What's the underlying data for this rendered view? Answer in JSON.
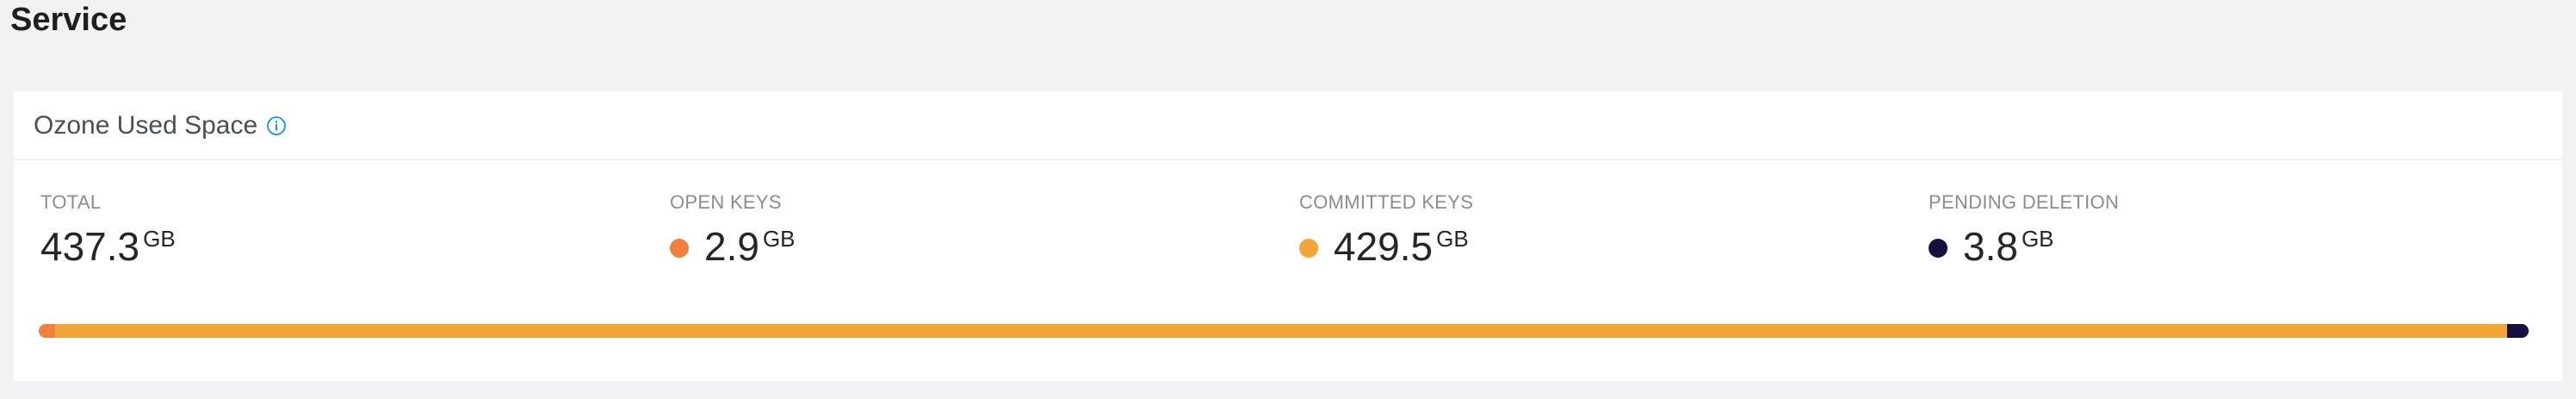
{
  "page": {
    "title": "Service"
  },
  "card": {
    "title": "Ozone Used Space",
    "info_icon": "info-circle-icon"
  },
  "stats": [
    {
      "label": "TOTAL",
      "value": "437.3",
      "unit": "GB"
    },
    {
      "label": "OPEN KEYS",
      "value": "2.9",
      "unit": "GB",
      "color": "#f0803c"
    },
    {
      "label": "COMMITTED KEYS",
      "value": "429.5",
      "unit": "GB",
      "color": "#f4a538"
    },
    {
      "label": "PENDING DELETION",
      "value": "3.8",
      "unit": "GB",
      "color": "#14103f"
    }
  ],
  "usage_bar": {
    "segments": [
      {
        "name": "open-keys",
        "value": 2.9,
        "color": "#f0803c"
      },
      {
        "name": "committed-keys",
        "value": 429.5,
        "color": "#f4a538"
      },
      {
        "name": "pending-deletion",
        "value": 3.8,
        "color": "#14103f"
      }
    ],
    "total": 437.3
  }
}
